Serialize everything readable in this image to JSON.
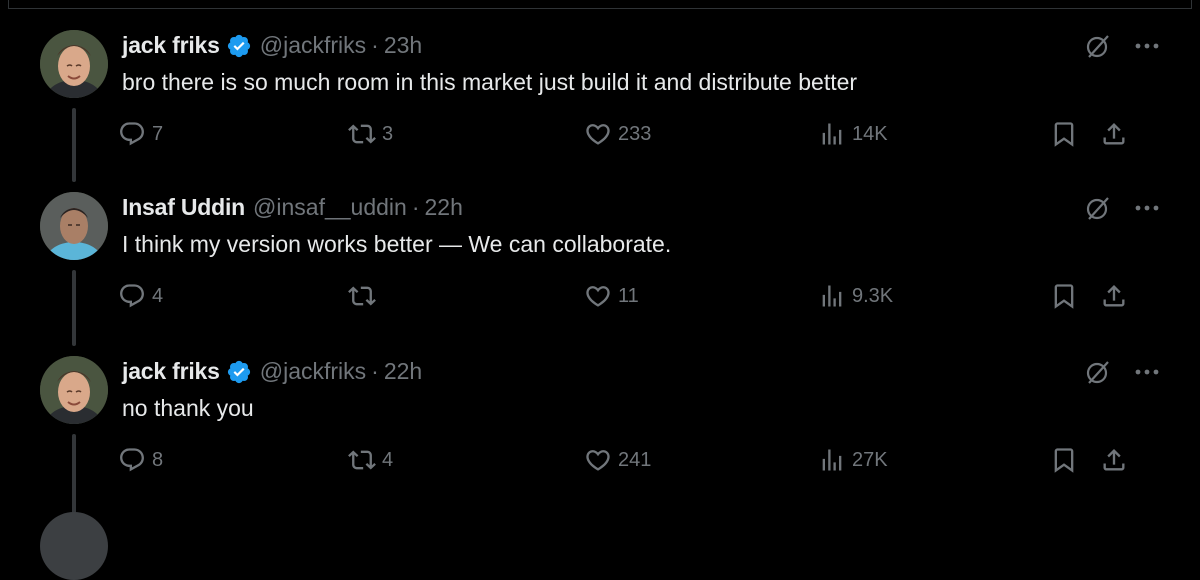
{
  "tweets": [
    {
      "name": "jack friks",
      "verified": true,
      "handle": "@jackfriks",
      "separator": "·",
      "time": "23h",
      "text": "bro there is so much room in this market just build it and distribute better",
      "replies": "7",
      "retweets": "3",
      "likes": "233",
      "views": "14K",
      "avatar_icon": "avatar-jack"
    },
    {
      "name": "Insaf Uddin",
      "verified": false,
      "handle": "@insaf__uddin",
      "separator": "·",
      "time": "22h",
      "text": "I think my version works better — We can collaborate.",
      "replies": "4",
      "retweets": "",
      "likes": "11",
      "views": "9.3K",
      "avatar_icon": "avatar-insaf"
    },
    {
      "name": "jack friks",
      "verified": true,
      "handle": "@jackfriks",
      "separator": "·",
      "time": "22h",
      "text": "no thank you",
      "replies": "8",
      "retweets": "4",
      "likes": "241",
      "views": "27K",
      "avatar_icon": "avatar-jack"
    }
  ],
  "colors": {
    "background": "#000000",
    "text_primary": "#e7e9ea",
    "text_secondary": "#71767b",
    "verified_blue": "#1d9bf0",
    "thread_line": "#333639"
  },
  "icons": [
    "reply-icon",
    "retweet-icon",
    "like-icon",
    "views-icon",
    "bookmark-icon",
    "share-icon",
    "grok-icon",
    "more-icon",
    "verified-badge-icon"
  ]
}
